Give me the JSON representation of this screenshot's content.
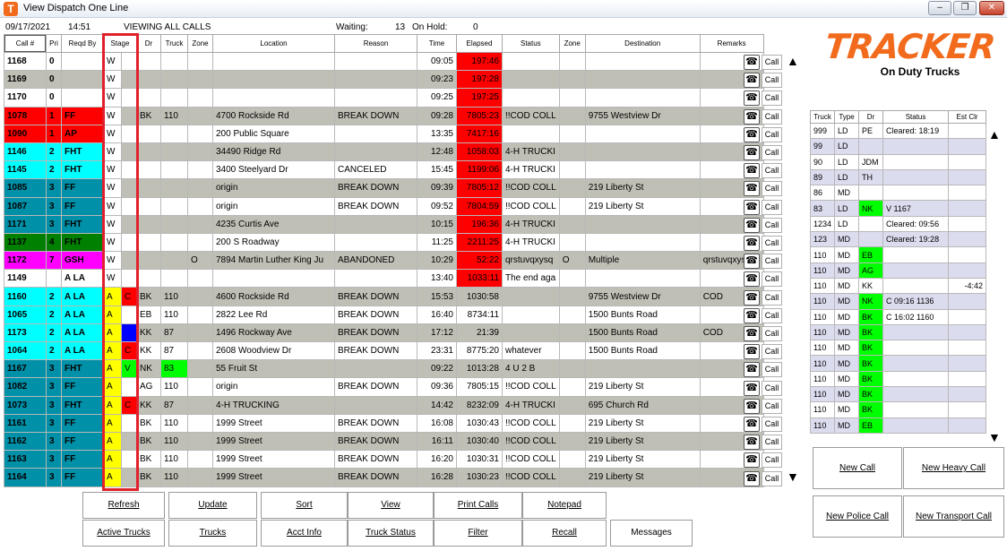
{
  "window": {
    "title": "View Dispatch One Line",
    "icon": "tracker-app-icon"
  },
  "info": {
    "date": "09/17/2021",
    "time": "14:51",
    "viewing": "VIEWING ALL CALLS",
    "waiting_label": "Waiting:",
    "waiting_count": "13",
    "hold_label": "On Hold:",
    "hold_count": "0"
  },
  "main_columns": [
    "Call #",
    "Pri",
    "Reqd By",
    "Stage",
    "Dr",
    "Truck",
    "Zone",
    "Location",
    "Reason",
    "Time",
    "Elapsed",
    "Status",
    "Zone",
    "Destination",
    "Remarks"
  ],
  "colors": {
    "red": "#ff0000",
    "cyan": "#00ffff",
    "teal": "#0090a8",
    "green": "#008000",
    "magenta": "#ff00ff",
    "yellow": "#ffff00",
    "blue": "#0000ff",
    "lime": "#00ff00",
    "alt_row": "#c0bfb5",
    "elapsed_red": "#ff0000"
  },
  "calls": [
    {
      "call": "1168",
      "pri": "0",
      "reqd": "",
      "s1": "W",
      "s2": "",
      "dr": "",
      "truck": "",
      "zone": "",
      "location": "",
      "reason": "",
      "time": "09:05",
      "elapsed": "197:46",
      "status": "",
      "zone2": "",
      "destination": "",
      "remarks": "",
      "call_bg": "",
      "alt": false,
      "elred": true,
      "s1bg": "",
      "s2bg": "",
      "truckbg": ""
    },
    {
      "call": "1169",
      "pri": "0",
      "reqd": "",
      "s1": "W",
      "s2": "",
      "dr": "",
      "truck": "",
      "zone": "",
      "location": "",
      "reason": "",
      "time": "09:23",
      "elapsed": "197:28",
      "status": "",
      "zone2": "",
      "destination": "",
      "remarks": "",
      "call_bg": "",
      "alt": true,
      "elred": true,
      "s1bg": "",
      "s2bg": "",
      "truckbg": ""
    },
    {
      "call": "1170",
      "pri": "0",
      "reqd": "",
      "s1": "W",
      "s2": "",
      "dr": "",
      "truck": "",
      "zone": "",
      "location": "",
      "reason": "",
      "time": "09:25",
      "elapsed": "197:25",
      "status": "",
      "zone2": "",
      "destination": "",
      "remarks": "",
      "call_bg": "",
      "alt": false,
      "elred": true,
      "s1bg": "",
      "s2bg": "",
      "truckbg": ""
    },
    {
      "call": "1078",
      "pri": "1",
      "reqd": "FF",
      "s1": "W",
      "s2": "",
      "dr": "BK",
      "truck": "110",
      "zone": "",
      "location": "4700 Rockside Rd",
      "reason": "BREAK DOWN",
      "time": "09:28",
      "elapsed": "7805:23",
      "status": "!!COD COLL",
      "zone2": "",
      "destination": "9755 Westview Dr",
      "remarks": "",
      "call_bg": "red",
      "alt": true,
      "elred": true,
      "s1bg": "",
      "s2bg": "",
      "truckbg": ""
    },
    {
      "call": "1090",
      "pri": "1",
      "reqd": "AP",
      "s1": "W",
      "s2": "",
      "dr": "",
      "truck": "",
      "zone": "",
      "location": "200 Public Square",
      "reason": "",
      "time": "13:35",
      "elapsed": "7417:16",
      "status": "",
      "zone2": "",
      "destination": "",
      "remarks": "",
      "call_bg": "red",
      "alt": false,
      "elred": true,
      "s1bg": "",
      "s2bg": "",
      "truckbg": ""
    },
    {
      "call": "1146",
      "pri": "2",
      "reqd": "FHT",
      "s1": "W",
      "s2": "",
      "dr": "",
      "truck": "",
      "zone": "",
      "location": "34490 Ridge Rd",
      "reason": "",
      "time": "12:48",
      "elapsed": "1058:03",
      "status": "4-H TRUCKI",
      "zone2": "",
      "destination": "",
      "remarks": "",
      "call_bg": "cyan",
      "alt": true,
      "elred": true,
      "s1bg": "",
      "s2bg": "",
      "truckbg": ""
    },
    {
      "call": "1145",
      "pri": "2",
      "reqd": "FHT",
      "s1": "W",
      "s2": "",
      "dr": "",
      "truck": "",
      "zone": "",
      "location": "3400 Steelyard Dr",
      "reason": "CANCELED",
      "time": "15:45",
      "elapsed": "1199:06",
      "status": "4-H TRUCKI",
      "zone2": "",
      "destination": "",
      "remarks": "",
      "call_bg": "cyan",
      "alt": false,
      "elred": true,
      "s1bg": "",
      "s2bg": "",
      "truckbg": ""
    },
    {
      "call": "1085",
      "pri": "3",
      "reqd": "FF",
      "s1": "W",
      "s2": "",
      "dr": "",
      "truck": "",
      "zone": "",
      "location": "origin",
      "reason": "BREAK DOWN",
      "time": "09:39",
      "elapsed": "7805:12",
      "status": "!!COD COLL",
      "zone2": "",
      "destination": "219 Liberty St",
      "remarks": "",
      "call_bg": "teal",
      "alt": true,
      "elred": true,
      "s1bg": "",
      "s2bg": "",
      "truckbg": ""
    },
    {
      "call": "1087",
      "pri": "3",
      "reqd": "FF",
      "s1": "W",
      "s2": "",
      "dr": "",
      "truck": "",
      "zone": "",
      "location": "origin",
      "reason": "BREAK DOWN",
      "time": "09:52",
      "elapsed": "7804:59",
      "status": "!!COD COLL",
      "zone2": "",
      "destination": "219 Liberty St",
      "remarks": "",
      "call_bg": "teal",
      "alt": false,
      "elred": true,
      "s1bg": "",
      "s2bg": "",
      "truckbg": ""
    },
    {
      "call": "1171",
      "pri": "3",
      "reqd": "FHT",
      "s1": "W",
      "s2": "",
      "dr": "",
      "truck": "",
      "zone": "",
      "location": "4235 Curtis Ave",
      "reason": "",
      "time": "10:15",
      "elapsed": "196:36",
      "status": "4-H TRUCKI",
      "zone2": "",
      "destination": "",
      "remarks": "",
      "call_bg": "teal",
      "alt": true,
      "elred": true,
      "s1bg": "",
      "s2bg": "",
      "truckbg": ""
    },
    {
      "call": "1137",
      "pri": "4",
      "reqd": "FHT",
      "s1": "W",
      "s2": "",
      "dr": "",
      "truck": "",
      "zone": "",
      "location": "200 S Roadway",
      "reason": "",
      "time": "11:25",
      "elapsed": "2211:25",
      "status": "4-H TRUCKI",
      "zone2": "",
      "destination": "",
      "remarks": "",
      "call_bg": "green",
      "alt": false,
      "elred": true,
      "s1bg": "",
      "s2bg": "",
      "truckbg": ""
    },
    {
      "call": "1172",
      "pri": "7",
      "reqd": "GSH",
      "s1": "W",
      "s2": "",
      "dr": "",
      "truck": "",
      "zone": "O",
      "location": "7894 Martin Luther King Ju",
      "reason": "ABANDONED",
      "time": "10:29",
      "elapsed": "52:22",
      "status": "qrstuvqxysq",
      "zone2": "O",
      "destination": "Multiple",
      "remarks": "qrstuvqxysqrs",
      "call_bg": "magenta",
      "alt": true,
      "elred": true,
      "s1bg": "",
      "s2bg": "",
      "truckbg": ""
    },
    {
      "call": "1149",
      "pri": "",
      "reqd": "A LA",
      "s1": "W",
      "s2": "",
      "dr": "",
      "truck": "",
      "zone": "",
      "location": "",
      "reason": "",
      "time": "13:40",
      "elapsed": "1033:11",
      "status": "The end aga",
      "zone2": "",
      "destination": "",
      "remarks": "",
      "call_bg": "",
      "alt": false,
      "elred": true,
      "s1bg": "",
      "s2bg": "",
      "truckbg": ""
    },
    {
      "call": "1160",
      "pri": "2",
      "reqd": "A LA",
      "s1": "A",
      "s2": "C",
      "dr": "BK",
      "truck": "110",
      "zone": "",
      "location": "4600 Rockside Rd",
      "reason": "BREAK DOWN",
      "time": "15:53",
      "elapsed": "1030:58",
      "status": "",
      "zone2": "",
      "destination": "9755 Westview Dr",
      "remarks": "COD",
      "call_bg": "cyan",
      "alt": true,
      "elred": false,
      "s1bg": "yellow",
      "s2bg": "red",
      "truckbg": ""
    },
    {
      "call": "1065",
      "pri": "2",
      "reqd": "A LA",
      "s1": "A",
      "s2": "",
      "dr": "EB",
      "truck": "110",
      "zone": "",
      "location": "2822 Lee Rd",
      "reason": "BREAK DOWN",
      "time": "16:40",
      "elapsed": "8734:11",
      "status": "",
      "zone2": "",
      "destination": "1500 Bunts Road",
      "remarks": "",
      "call_bg": "cyan",
      "alt": false,
      "elred": false,
      "s1bg": "yellow",
      "s2bg": "",
      "truckbg": ""
    },
    {
      "call": "1173",
      "pri": "2",
      "reqd": "A LA",
      "s1": "A",
      "s2": "",
      "dr": "KK",
      "truck": "87",
      "zone": "",
      "location": "1496 Rockway Ave",
      "reason": "BREAK DOWN",
      "time": "17:12",
      "elapsed": "21:39",
      "status": "",
      "zone2": "",
      "destination": "1500 Bunts Road",
      "remarks": "COD",
      "call_bg": "cyan",
      "alt": true,
      "elred": false,
      "s1bg": "yellow",
      "s2bg": "blue",
      "truckbg": ""
    },
    {
      "call": "1064",
      "pri": "2",
      "reqd": "A LA",
      "s1": "A",
      "s2": "C",
      "dr": "KK",
      "truck": "87",
      "zone": "",
      "location": "2608 Woodview Dr",
      "reason": "BREAK DOWN",
      "time": "23:31",
      "elapsed": "8775:20",
      "status": "whatever",
      "zone2": "",
      "destination": "1500 Bunts Road",
      "remarks": "",
      "call_bg": "cyan",
      "alt": false,
      "elred": false,
      "s1bg": "yellow",
      "s2bg": "red",
      "truckbg": ""
    },
    {
      "call": "1167",
      "pri": "3",
      "reqd": "FHT",
      "s1": "A",
      "s2": "V",
      "dr": "NK",
      "truck": "83",
      "zone": "",
      "location": "55 Fruit St",
      "reason": "",
      "time": "09:22",
      "elapsed": "1013:28",
      "status": "4 U 2 B",
      "zone2": "",
      "destination": "",
      "remarks": "",
      "call_bg": "teal",
      "alt": true,
      "elred": false,
      "s1bg": "yellow",
      "s2bg": "lime",
      "truckbg": "lime"
    },
    {
      "call": "1082",
      "pri": "3",
      "reqd": "FF",
      "s1": "A",
      "s2": "",
      "dr": "AG",
      "truck": "110",
      "zone": "",
      "location": "origin",
      "reason": "BREAK DOWN",
      "time": "09:36",
      "elapsed": "7805:15",
      "status": "!!COD COLL",
      "zone2": "",
      "destination": "219 Liberty St",
      "remarks": "",
      "call_bg": "teal",
      "alt": false,
      "elred": false,
      "s1bg": "yellow",
      "s2bg": "",
      "truckbg": ""
    },
    {
      "call": "1073",
      "pri": "3",
      "reqd": "FHT",
      "s1": "A",
      "s2": "C",
      "dr": "KK",
      "truck": "87",
      "zone": "",
      "location": "4-H TRUCKING",
      "reason": "",
      "time": "14:42",
      "elapsed": "8232:09",
      "status": "4-H TRUCKI",
      "zone2": "",
      "destination": "695 Church Rd",
      "remarks": "",
      "call_bg": "teal",
      "alt": true,
      "elred": false,
      "s1bg": "yellow",
      "s2bg": "red",
      "truckbg": ""
    },
    {
      "call": "1161",
      "pri": "3",
      "reqd": "FF",
      "s1": "A",
      "s2": "",
      "dr": "BK",
      "truck": "110",
      "zone": "",
      "location": "1999 Street",
      "reason": "BREAK DOWN",
      "time": "16:08",
      "elapsed": "1030:43",
      "status": "!!COD COLL",
      "zone2": "",
      "destination": "219 Liberty St",
      "remarks": "",
      "call_bg": "teal",
      "alt": false,
      "elred": false,
      "s1bg": "yellow",
      "s2bg": "",
      "truckbg": ""
    },
    {
      "call": "1162",
      "pri": "3",
      "reqd": "FF",
      "s1": "A",
      "s2": "",
      "dr": "BK",
      "truck": "110",
      "zone": "",
      "location": "1999 Street",
      "reason": "BREAK DOWN",
      "time": "16:11",
      "elapsed": "1030:40",
      "status": "!!COD COLL",
      "zone2": "",
      "destination": "219 Liberty St",
      "remarks": "",
      "call_bg": "teal",
      "alt": true,
      "elred": false,
      "s1bg": "yellow",
      "s2bg": "",
      "truckbg": ""
    },
    {
      "call": "1163",
      "pri": "3",
      "reqd": "FF",
      "s1": "A",
      "s2": "",
      "dr": "BK",
      "truck": "110",
      "zone": "",
      "location": "1999 Street",
      "reason": "BREAK DOWN",
      "time": "16:20",
      "elapsed": "1030:31",
      "status": "!!COD COLL",
      "zone2": "",
      "destination": "219 Liberty St",
      "remarks": "",
      "call_bg": "teal",
      "alt": false,
      "elred": false,
      "s1bg": "yellow",
      "s2bg": "",
      "truckbg": ""
    },
    {
      "call": "1164",
      "pri": "3",
      "reqd": "FF",
      "s1": "A",
      "s2": "",
      "dr": "BK",
      "truck": "110",
      "zone": "",
      "location": "1999 Street",
      "reason": "BREAK DOWN",
      "time": "16:28",
      "elapsed": "1030:23",
      "status": "!!COD COLL",
      "zone2": "",
      "destination": "219 Liberty St",
      "remarks": "",
      "call_bg": "teal",
      "alt": true,
      "elred": false,
      "s1bg": "yellow",
      "s2bg": "",
      "truckbg": ""
    }
  ],
  "side_call_label": "Call",
  "side_phone_icon": "phone-icon",
  "logo": {
    "text": "TRACKER",
    "subtitle": "On Duty Trucks"
  },
  "truck_columns": [
    "Truck",
    "Type",
    "Dr",
    "Status",
    "Est Clr"
  ],
  "trucks": [
    {
      "truck": "999",
      "type": "LD",
      "dr": "PE",
      "status": "Cleared: 18:19",
      "est": "",
      "drbg": "",
      "alt": false
    },
    {
      "truck": "99",
      "type": "LD",
      "dr": "",
      "status": "",
      "est": "",
      "drbg": "",
      "alt": true
    },
    {
      "truck": "90",
      "type": "LD",
      "dr": "JDM",
      "status": "",
      "est": "",
      "drbg": "",
      "alt": false
    },
    {
      "truck": "89",
      "type": "LD",
      "dr": "TH",
      "status": "",
      "est": "",
      "drbg": "",
      "alt": true
    },
    {
      "truck": "86",
      "type": "MD",
      "dr": "",
      "status": "",
      "est": "",
      "drbg": "",
      "alt": false
    },
    {
      "truck": "83",
      "type": "LD",
      "dr": "NK",
      "status": "V 1167",
      "est": "",
      "drbg": "lime",
      "alt": true
    },
    {
      "truck": "1234",
      "type": "LD",
      "dr": "",
      "status": "Cleared: 09:56",
      "est": "",
      "drbg": "",
      "alt": false
    },
    {
      "truck": "123",
      "type": "MD",
      "dr": "",
      "status": "Cleared: 19:28",
      "est": "",
      "drbg": "",
      "alt": true
    },
    {
      "truck": "110",
      "type": "MD",
      "dr": "EB",
      "status": "",
      "est": "",
      "drbg": "lime",
      "alt": false
    },
    {
      "truck": "110",
      "type": "MD",
      "dr": "AG",
      "status": "",
      "est": "",
      "drbg": "lime",
      "alt": true
    },
    {
      "truck": "110",
      "type": "MD",
      "dr": "KK",
      "status": "",
      "est": "-4:42",
      "drbg": "",
      "alt": false
    },
    {
      "truck": "110",
      "type": "MD",
      "dr": "NK",
      "status": "C 09:16 1136",
      "est": "",
      "drbg": "lime",
      "alt": true
    },
    {
      "truck": "110",
      "type": "MD",
      "dr": "BK",
      "status": "C 16:02 1160",
      "est": "",
      "drbg": "lime",
      "alt": false
    },
    {
      "truck": "110",
      "type": "MD",
      "dr": "BK",
      "status": "",
      "est": "",
      "drbg": "lime",
      "alt": true
    },
    {
      "truck": "110",
      "type": "MD",
      "dr": "BK",
      "status": "",
      "est": "",
      "drbg": "lime",
      "alt": false
    },
    {
      "truck": "110",
      "type": "MD",
      "dr": "BK",
      "status": "",
      "est": "",
      "drbg": "lime",
      "alt": true
    },
    {
      "truck": "110",
      "type": "MD",
      "dr": "BK",
      "status": "",
      "est": "",
      "drbg": "lime",
      "alt": false
    },
    {
      "truck": "110",
      "type": "MD",
      "dr": "BK",
      "status": "",
      "est": "",
      "drbg": "lime",
      "alt": true
    },
    {
      "truck": "110",
      "type": "MD",
      "dr": "BK",
      "status": "",
      "est": "",
      "drbg": "lime",
      "alt": false
    },
    {
      "truck": "110",
      "type": "MD",
      "dr": "EB",
      "status": "",
      "est": "",
      "drbg": "lime",
      "alt": true
    }
  ],
  "buttons": {
    "refresh": "Refresh",
    "update": "Update",
    "sort": "Sort",
    "view": "View",
    "print_calls": "Print Calls",
    "notepad": "Notepad",
    "active_trucks": "Active Trucks",
    "trucks": "Trucks",
    "acct_info": "Acct Info",
    "truck_status": "Truck Status",
    "filter": "Filter",
    "recall": "Recall",
    "messages": "Messages",
    "new_call": "New Call",
    "new_heavy_call": "New Heavy Call",
    "new_police_call": "New Police Call",
    "new_transport_call": "New Transport Call"
  }
}
